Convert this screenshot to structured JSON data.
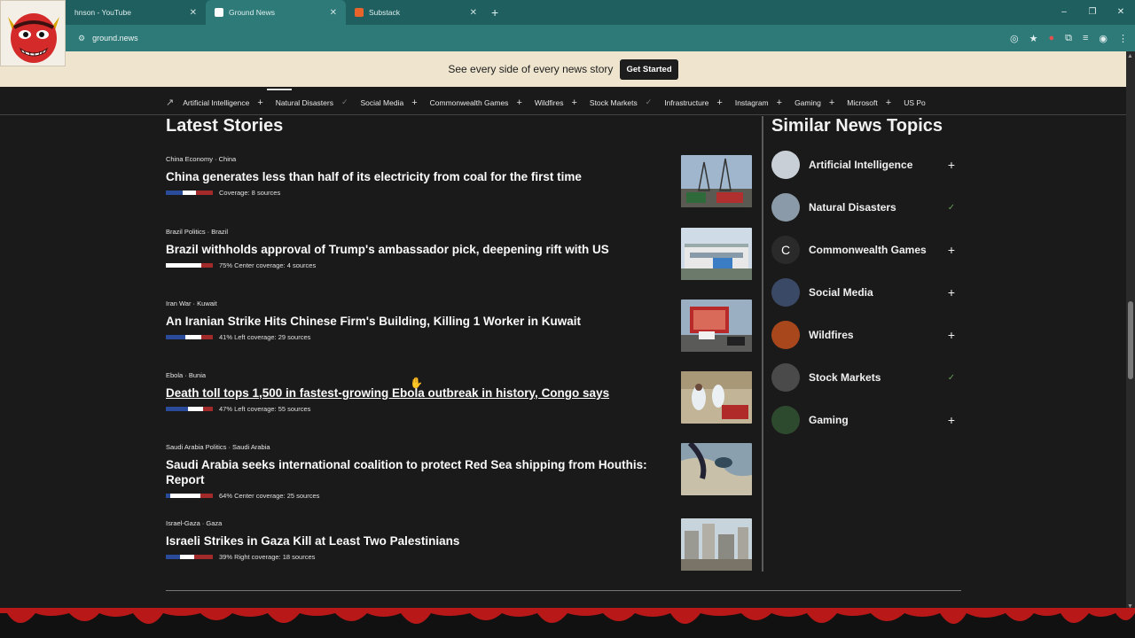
{
  "browser": {
    "tabs": [
      {
        "label": "hnson - YouTube",
        "favicon_color": "#d22",
        "active": false
      },
      {
        "label": "Ground News",
        "favicon_color": "#fff",
        "active": true
      },
      {
        "label": "Substack",
        "favicon_color": "#e8642a",
        "active": false
      }
    ],
    "url": "ground.news",
    "new_tab_symbol": "+",
    "close_symbol": "✕",
    "window_controls": [
      "–",
      "❐",
      "✕"
    ],
    "addr_icons": [
      "eye-slash-icon",
      "star-icon",
      "extension-badge-icon",
      "puzzle-icon",
      "media-icon",
      "profile-icon",
      "menu-icon"
    ]
  },
  "banner": {
    "text": "See every side of every news story",
    "button": "Get Started"
  },
  "topic_strip": [
    {
      "label": "Artificial Intelligence",
      "action": "+"
    },
    {
      "label": "Natural Disasters",
      "action": "✓"
    },
    {
      "label": "Social Media",
      "action": "+"
    },
    {
      "label": "Commonwealth Games",
      "action": "+"
    },
    {
      "label": "Wildfires",
      "action": "+"
    },
    {
      "label": "Stock Markets",
      "action": "✓"
    },
    {
      "label": "Infrastructure",
      "action": "+"
    },
    {
      "label": "Instagram",
      "action": "+"
    },
    {
      "label": "Gaming",
      "action": "+"
    },
    {
      "label": "Microsoft",
      "action": "+"
    },
    {
      "label": "US Po",
      "action": ""
    }
  ],
  "latest": {
    "title": "Latest Stories",
    "stories": [
      {
        "category": "China Economy · China",
        "headline": "China generates less than half of its electricity from coal for the first time",
        "coverage": "Coverage: 8 sources",
        "bar": [
          0.35,
          0.3,
          0.35
        ],
        "thumb": "power-plant"
      },
      {
        "category": "Brazil Politics · Brazil",
        "headline": "Brazil withholds approval of Trump's ambassador pick, deepening rift with US",
        "coverage": "75% Center coverage: 4 sources",
        "bar": [
          0.0,
          0.75,
          0.25
        ],
        "thumb": "embassy"
      },
      {
        "category": "Iran War · Kuwait",
        "headline": "An Iranian Strike Hits Chinese Firm's Building, Killing 1 Worker in Kuwait",
        "coverage": "41% Left coverage: 29 sources",
        "bar": [
          0.41,
          0.35,
          0.24
        ],
        "thumb": "street"
      },
      {
        "category": "Ebola · Bunia",
        "headline": "Death toll tops 1,500 in fastest-growing Ebola outbreak in history, Congo says",
        "coverage": "47% Left coverage: 55 sources",
        "bar": [
          0.47,
          0.33,
          0.2
        ],
        "thumb": "medical"
      },
      {
        "category": "Saudi Arabia Politics · Saudi Arabia",
        "headline": "Saudi Arabia seeks international coalition to protect Red Sea shipping from Houthis: Report",
        "coverage": "64% Center coverage: 25 sources",
        "bar": [
          0.1,
          0.64,
          0.26
        ],
        "thumb": "satellite"
      },
      {
        "category": "Israel-Gaza · Gaza",
        "headline": "Israeli Strikes in Gaza Kill at Least Two Palestinians",
        "coverage": "39% Right coverage: 18 sources",
        "bar": [
          0.3,
          0.31,
          0.39
        ],
        "thumb": "ruins"
      }
    ]
  },
  "sidebar": {
    "title": "Similar News Topics",
    "items": [
      {
        "name": "Artificial Intelligence",
        "action": "+",
        "avatar_color": "#c9cfd6",
        "avatar_text": ""
      },
      {
        "name": "Natural Disasters",
        "action": "✓",
        "avatar_color": "#8a9aa8",
        "avatar_text": ""
      },
      {
        "name": "Commonwealth Games",
        "action": "+",
        "avatar_color": "#2a2a2a",
        "avatar_text": "C"
      },
      {
        "name": "Social Media",
        "action": "+",
        "avatar_color": "#3a4a66",
        "avatar_text": ""
      },
      {
        "name": "Wildfires",
        "action": "+",
        "avatar_color": "#a8461c",
        "avatar_text": ""
      },
      {
        "name": "Stock Markets",
        "action": "✓",
        "avatar_color": "#4a4a4a",
        "avatar_text": ""
      },
      {
        "name": "Gaming",
        "action": "+",
        "avatar_color": "#2e4a2e",
        "avatar_text": ""
      }
    ]
  }
}
